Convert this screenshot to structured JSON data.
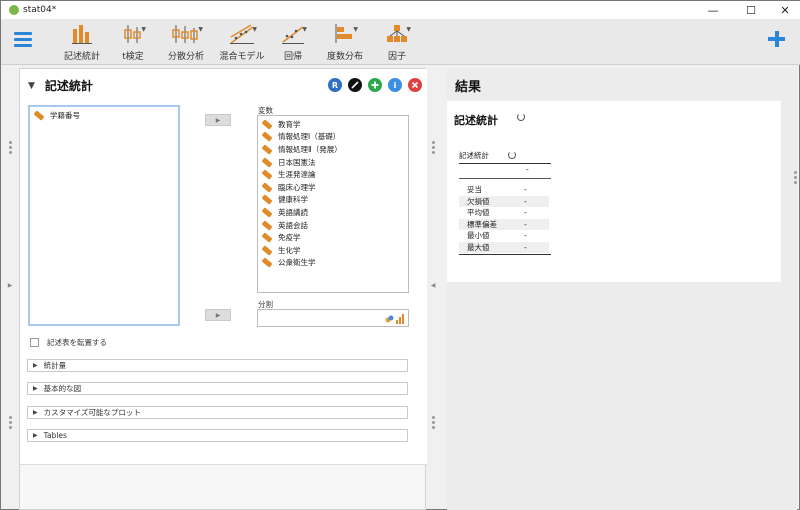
{
  "window": {
    "title": "stat04*",
    "min": "—",
    "max": "☐",
    "close": "✕"
  },
  "toolbar": {
    "items": [
      {
        "label": "記述統計"
      },
      {
        "label": "t検定"
      },
      {
        "label": "分散分析"
      },
      {
        "label": "混合モデル"
      },
      {
        "label": "回帰"
      },
      {
        "label": "度数分布"
      },
      {
        "label": "因子"
      }
    ]
  },
  "analysis": {
    "title": "記述統計",
    "source_vars": [
      "学籍番号"
    ],
    "variables_label": "変数",
    "variables": [
      "教育学",
      "情報処理Ⅰ（基礎）",
      "情報処理Ⅱ（発展）",
      "日本国憲法",
      "生涯発達論",
      "臨床心理学",
      "健康科学",
      "英語講読",
      "英語会話",
      "免疫学",
      "生化学",
      "公衆衛生学"
    ],
    "split_label": "分割",
    "transpose_label": "記述表を転置する",
    "sections": [
      "統計量",
      "基本的な図",
      "カスタマイズ可能なプロット",
      "Tables"
    ],
    "btn_r": "R",
    "btn_info": "i"
  },
  "results": {
    "header": "結果",
    "title": "記述統計",
    "table_title": "記述統計",
    "header_dash": "-",
    "rows": [
      {
        "label": "妥当",
        "value": "-"
      },
      {
        "label": "欠損値",
        "value": "-"
      },
      {
        "label": "平均値",
        "value": "-"
      },
      {
        "label": "標準偏差",
        "value": "-"
      },
      {
        "label": "最小値",
        "value": "-"
      },
      {
        "label": "最大値",
        "value": "-"
      }
    ]
  },
  "colors": {
    "accent": "#2a86d8",
    "r_button": "#2f6fc4",
    "green": "#2aa84a",
    "info": "#3d8fe0",
    "close": "#e04040",
    "ruler": "#e08a2c"
  }
}
